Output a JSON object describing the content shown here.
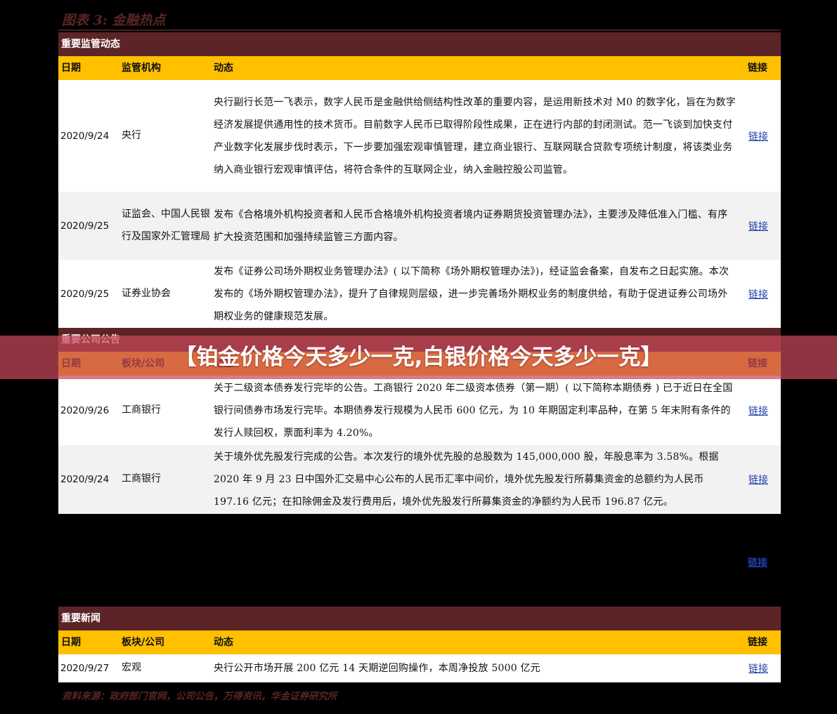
{
  "figure_title": "图表 3: 金融热点",
  "headers": {
    "date": "日期",
    "org": "监管机构",
    "org2": "板块/公司",
    "body": "动态",
    "link": "链接"
  },
  "section1": {
    "title": "重要监管动态",
    "rows": [
      {
        "date": "2020/9/24",
        "org": "央行",
        "body": "央行副行长范一飞表示，数字人民币是金融供给侧结构性改革的重要内容，是运用新技术对 M0 的数字化，旨在为数字经济发展提供通用性的技术货币。目前数字人民币已取得阶段性成果，正在进行内部的封闭测试。范一飞谈到加快支付产业数字化发展步伐时表示，下一步要加强宏观审慎管理，建立商业银行、互联网联合贷款专项统计制度，将该类业务纳入商业银行宏观审慎评估，将符合条件的互联网企业，纳入金融控股公司监管。",
        "link": "链接"
      },
      {
        "date": "2020/9/25",
        "org": "证监会、中国人民银行及国家外汇管理局",
        "body": "发布《合格境外机构投资者和人民币合格境外机构投资者境内证券期货投资管理办法》，主要涉及降低准入门槛、有序扩大投资范围和加强持续监管三方面内容。",
        "link": "链接"
      },
      {
        "date": "2020/9/25",
        "org": "证券业协会",
        "body": "发布《证券公司场外期权业务管理办法》( 以下简称《场外期权管理办法》)，经证监会备案，自发布之日起实施。本次发布的《场外期权管理办法》，提升了自律规则层级，进一步完善场外期权业务的制度供给，有助于促进证券公司场外期权业务的健康规范发展。",
        "link": "链接"
      }
    ]
  },
  "section2": {
    "title": "重要公司公告",
    "rows": [
      {
        "date": "2020/9/26",
        "org": "工商银行",
        "body": "关于二级资本债券发行完毕的公告。工商银行 2020 年二级资本债券（第一期）( 以下简称本期债券 ) 已于近日在全国银行间债券市场发行完毕。本期债券发行规模为人民币 600 亿元，为 10 年期固定利率品种，在第 5 年末附有条件的发行人赎回权，票面利率为 4.20%。",
        "link": "链接"
      },
      {
        "date": "2020/9/24",
        "org": "工商银行",
        "body": "关于境外优先股发行完成的公告。本次发行的境外优先股的总股数为 145,000,000 股，年股息率为 3.58%。根据 2020 年 9 月 23 日中国外汇交易中心公布的人民币汇率中间价，境外优先股发行所募集资金的总额约为人民币 197.16 亿元；在扣除佣金及发行费用后，境外优先股发行所募集资金的净额约为人民币 196.87 亿元。",
        "link": "链接"
      }
    ]
  },
  "stray_link": "链接",
  "section3": {
    "title": "重要新闻",
    "rows": [
      {
        "date": "2020/9/27",
        "org": "宏观",
        "body": "央行公开市场开展 200 亿元 14 天期逆回购操作，本周净投放 5000 亿元",
        "link": "链接"
      }
    ]
  },
  "overlay_title": "【铂金价格今天多少一克,白银价格今天多少一克】",
  "source": "资料来源：政府部门官网，公司公告，万得资讯，华金证券研究所"
}
